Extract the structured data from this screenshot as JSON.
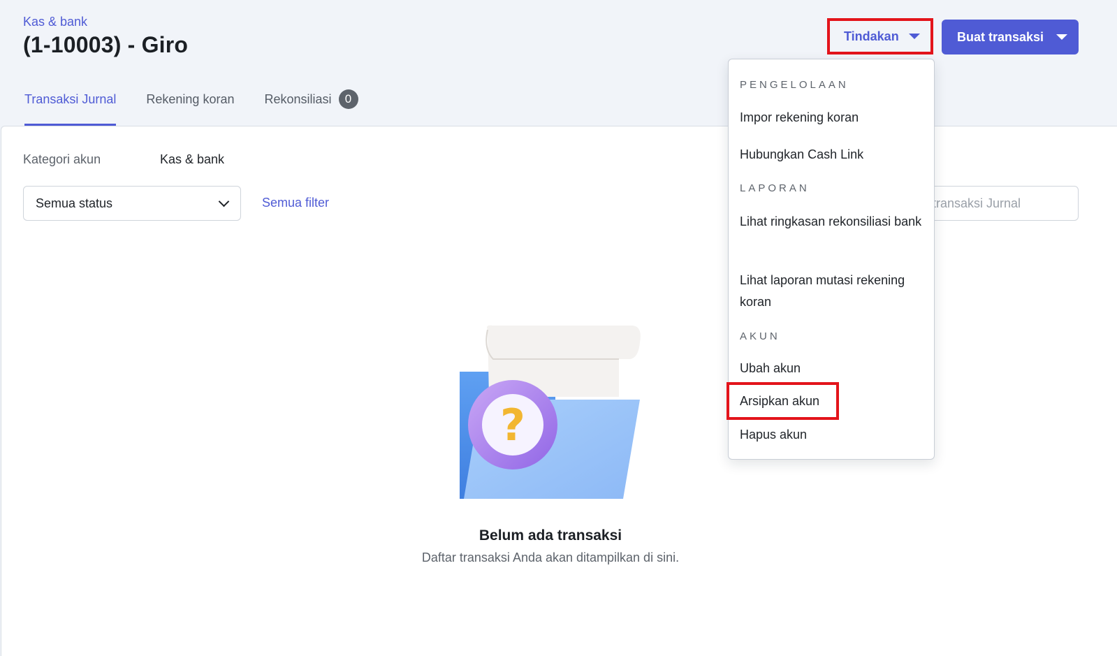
{
  "header": {
    "breadcrumb": "Kas & bank",
    "title": "(1-10003) - Giro",
    "actions_label": "Tindakan",
    "create_label": "Buat transaksi",
    "accent": "#4f5bd5"
  },
  "tabs": [
    {
      "label": "Transaksi Jurnal",
      "active": true
    },
    {
      "label": "Rekening koran",
      "active": false
    },
    {
      "label": "Rekonsiliasi",
      "badge": "0",
      "active": false
    }
  ],
  "filters": {
    "category_label": "Kategori akun",
    "category_value": "Kas & bank",
    "status_value": "Semua status",
    "all_filters": "Semua filter",
    "search_placeholder": "Cari transaksi Jurnal"
  },
  "menu": {
    "sections": [
      {
        "title": "PENGELOLAAN",
        "items": [
          "Impor rekening koran",
          "Hubungkan Cash Link"
        ]
      },
      {
        "title": "LAPORAN",
        "items": [
          "Lihat ringkasan rekonsiliasi bank",
          "Lihat laporan mutasi rekening koran"
        ]
      },
      {
        "title": "AKUN",
        "items": [
          "Ubah akun",
          "Arsipkan akun",
          "Hapus akun"
        ]
      }
    ]
  },
  "empty_state": {
    "title": "Belum ada transaksi",
    "subtitle": "Daftar transaksi Anda akan ditampilkan di sini.",
    "icon": "folder-question-icon"
  },
  "highlight_color": "#e3141b"
}
